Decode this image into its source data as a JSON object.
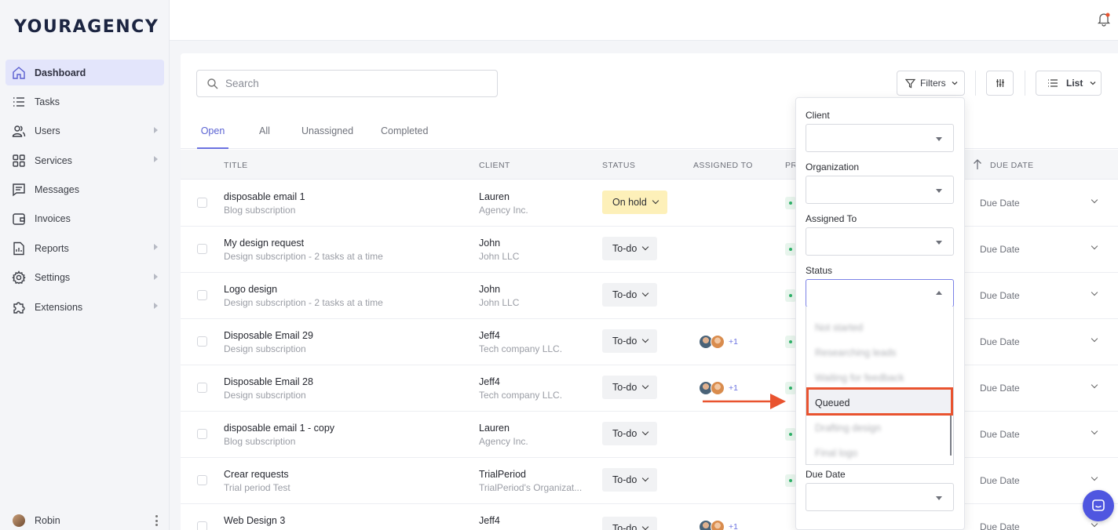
{
  "brand": {
    "logo": "YOURAGENCY"
  },
  "sidebar": {
    "items": [
      {
        "label": "Dashboard",
        "icon": "home-icon",
        "active": true
      },
      {
        "label": "Tasks",
        "icon": "list-icon"
      },
      {
        "label": "Users",
        "icon": "users-icon",
        "submenu": true
      },
      {
        "label": "Services",
        "icon": "grid-icon",
        "submenu": true
      },
      {
        "label": "Messages",
        "icon": "chat-icon"
      },
      {
        "label": "Invoices",
        "icon": "wallet-icon"
      },
      {
        "label": "Reports",
        "icon": "report-icon",
        "submenu": true
      },
      {
        "label": "Settings",
        "icon": "gear-icon",
        "submenu": true
      },
      {
        "label": "Extensions",
        "icon": "puzzle-icon",
        "submenu": true
      }
    ],
    "user": {
      "name": "Robin"
    }
  },
  "toolbar": {
    "search_placeholder": "Search",
    "filters_label": "Filters",
    "view_label": "List"
  },
  "tabs": [
    "Open",
    "All",
    "Unassigned",
    "Completed"
  ],
  "columns": {
    "title": "TITLE",
    "client": "CLIENT",
    "status": "STATUS",
    "assigned": "ASSIGNED TO",
    "priority": "PR",
    "due": "DUE DATE"
  },
  "rows": [
    {
      "title": "disposable email 1",
      "subtitle": "Blog subscription",
      "client": "Lauren",
      "org": "Agency Inc.",
      "status": "On hold",
      "assignees": "",
      "due": "Due Date"
    },
    {
      "title": "My design request",
      "subtitle": "Design subscription - 2 tasks at a time",
      "client": "John",
      "org": "John LLC",
      "status": "To-do",
      "assignees": "",
      "due": "Due Date"
    },
    {
      "title": "Logo design",
      "subtitle": "Design subscription - 2 tasks at a time",
      "client": "John",
      "org": "John LLC",
      "status": "To-do",
      "assignees": "",
      "due": "Due Date"
    },
    {
      "title": "Disposable Email 29",
      "subtitle": "Design subscription",
      "client": "Jeff4",
      "org": "Tech company LLC.",
      "status": "To-do",
      "assignees": "+1",
      "due": "Due Date"
    },
    {
      "title": "Disposable Email 28",
      "subtitle": "Design subscription",
      "client": "Jeff4",
      "org": "Tech company LLC.",
      "status": "To-do",
      "assignees": "+1",
      "due": "Due Date"
    },
    {
      "title": "disposable email 1 - copy",
      "subtitle": "Blog subscription",
      "client": "Lauren",
      "org": "Agency Inc.",
      "status": "To-do",
      "assignees": "",
      "due": "Due Date"
    },
    {
      "title": "Crear requests",
      "subtitle": "Trial period Test",
      "client": "TrialPeriod",
      "org": "TrialPeriod's Organizat...",
      "status": "To-do",
      "assignees": "",
      "due": "Due Date"
    },
    {
      "title": "Web Design 3",
      "subtitle": "",
      "client": "Jeff4",
      "org": "",
      "status": "To-do",
      "assignees": "+1",
      "due": "Due Date"
    }
  ],
  "filter_panel": {
    "client_label": "Client",
    "organization_label": "Organization",
    "assigned_label": "Assigned To",
    "status_label": "Status",
    "due_label": "Due Date",
    "status_options": [
      "Not started",
      "Researching leads",
      "Waiting for feedback",
      "Queued",
      "Drafting design",
      "Final logo"
    ],
    "highlighted_option": "Queued"
  },
  "colors": {
    "accent": "#6b72e0",
    "highlight": "#e9532f",
    "on_hold": "#fdf0b9",
    "chat_button": "#4f56e0"
  }
}
